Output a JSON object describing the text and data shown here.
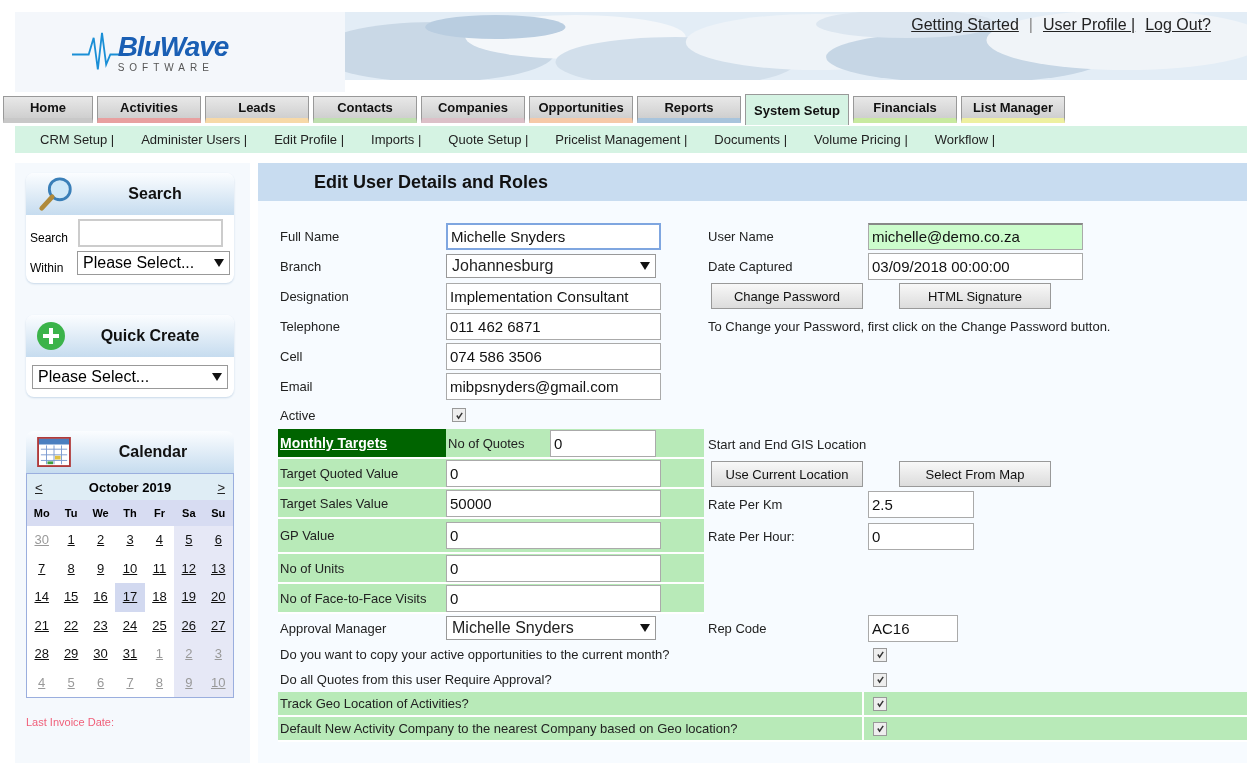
{
  "header": {
    "logo": {
      "name": "BluWave",
      "tagline": "SOFTWARE"
    },
    "links": [
      "Getting Started",
      "User Profile |",
      "Log Out?"
    ],
    "separator": "|"
  },
  "tabs": [
    {
      "label": "Home",
      "selected": false,
      "color": "#c8c8c8"
    },
    {
      "label": "Activities",
      "selected": false,
      "color": "#e8a0a0"
    },
    {
      "label": "Leads",
      "selected": false,
      "color": "#f7d9a8"
    },
    {
      "label": "Contacts",
      "selected": false,
      "color": "#bfe0b0"
    },
    {
      "label": "Companies",
      "selected": false,
      "color": "#dcc0c8"
    },
    {
      "label": "Opportunities",
      "selected": false,
      "color": "#f6c9a8"
    },
    {
      "label": "Reports",
      "selected": false,
      "color": "#a8c4dc"
    },
    {
      "label": "System Setup",
      "selected": true,
      "color": "#d5f3e3"
    },
    {
      "label": "Financials",
      "selected": false,
      "color": "#c8eaa0"
    },
    {
      "label": "List Manager",
      "selected": false,
      "color": "#eef0a0"
    }
  ],
  "subnav": [
    "CRM Setup |",
    "Administer Users |",
    "Edit Profile |",
    "Imports |",
    "Quote Setup |",
    "Pricelist Management |",
    "Documents |",
    "Volume Pricing |",
    "Workflow |"
  ],
  "sidebar": {
    "search": {
      "title": "Search",
      "search_label": "Search",
      "within_label": "Within",
      "within_value": "Please Select..."
    },
    "quick_create": {
      "title": "Quick Create",
      "value": "Please Select..."
    },
    "calendar": {
      "title": "Calendar",
      "prev": "<",
      "month": "October 2019",
      "next": ">",
      "weekdays": [
        "Mo",
        "Tu",
        "We",
        "Th",
        "Fr",
        "Sa",
        "Su"
      ],
      "weeks": [
        [
          {
            "day": "30",
            "muted": true,
            "selected": false
          },
          {
            "day": "1",
            "muted": false,
            "selected": false
          },
          {
            "day": "2",
            "muted": false,
            "selected": false
          },
          {
            "day": "3",
            "muted": false,
            "selected": false
          },
          {
            "day": "4",
            "muted": false,
            "selected": false
          },
          {
            "day": "5",
            "muted": false,
            "selected": false
          },
          {
            "day": "6",
            "muted": false,
            "selected": false
          }
        ],
        [
          {
            "day": "7",
            "muted": false,
            "selected": false
          },
          {
            "day": "8",
            "muted": false,
            "selected": false
          },
          {
            "day": "9",
            "muted": false,
            "selected": false
          },
          {
            "day": "10",
            "muted": false,
            "selected": false
          },
          {
            "day": "11",
            "muted": false,
            "selected": false
          },
          {
            "day": "12",
            "muted": false,
            "selected": false
          },
          {
            "day": "13",
            "muted": false,
            "selected": false
          }
        ],
        [
          {
            "day": "14",
            "muted": false,
            "selected": false
          },
          {
            "day": "15",
            "muted": false,
            "selected": false
          },
          {
            "day": "16",
            "muted": false,
            "selected": false
          },
          {
            "day": "17",
            "muted": false,
            "selected": true
          },
          {
            "day": "18",
            "muted": false,
            "selected": false
          },
          {
            "day": "19",
            "muted": false,
            "selected": false
          },
          {
            "day": "20",
            "muted": false,
            "selected": false
          }
        ],
        [
          {
            "day": "21",
            "muted": false,
            "selected": false
          },
          {
            "day": "22",
            "muted": false,
            "selected": false
          },
          {
            "day": "23",
            "muted": false,
            "selected": false
          },
          {
            "day": "24",
            "muted": false,
            "selected": false
          },
          {
            "day": "25",
            "muted": false,
            "selected": false
          },
          {
            "day": "26",
            "muted": false,
            "selected": false
          },
          {
            "day": "27",
            "muted": false,
            "selected": false
          }
        ],
        [
          {
            "day": "28",
            "muted": false,
            "selected": false
          },
          {
            "day": "29",
            "muted": false,
            "selected": false
          },
          {
            "day": "30",
            "muted": false,
            "selected": false
          },
          {
            "day": "31",
            "muted": false,
            "selected": false
          },
          {
            "day": "1",
            "muted": true,
            "selected": false
          },
          {
            "day": "2",
            "muted": true,
            "selected": false
          },
          {
            "day": "3",
            "muted": true,
            "selected": false
          }
        ],
        [
          {
            "day": "4",
            "muted": true,
            "selected": false
          },
          {
            "day": "5",
            "muted": true,
            "selected": false
          },
          {
            "day": "6",
            "muted": true,
            "selected": false
          },
          {
            "day": "7",
            "muted": true,
            "selected": false
          },
          {
            "day": "8",
            "muted": true,
            "selected": false
          },
          {
            "day": "9",
            "muted": true,
            "selected": false
          },
          {
            "day": "10",
            "muted": true,
            "selected": false
          }
        ]
      ]
    },
    "last_invoice": "Last Invoice Date:"
  },
  "form": {
    "title": "Edit User Details and Roles",
    "rows": [
      {
        "left": {
          "kind": "text",
          "label": "Full Name",
          "value": "Michelle Snyders",
          "focused": true
        },
        "right": {
          "kind": "text",
          "label": "User Name",
          "value": "michelle@demo.co.za",
          "highlighted": true
        }
      },
      {
        "left": {
          "kind": "select",
          "label": "Branch",
          "value": "Johannesburg"
        },
        "right": {
          "kind": "text",
          "label": "Date Captured",
          "value": "03/09/2018 00:00:00",
          "highlighted": false
        }
      },
      {
        "left": {
          "kind": "text",
          "label": "Designation",
          "value": "Implementation Consultant",
          "focused": false
        },
        "right": {
          "kind": "buttons",
          "buttons": [
            "Change Password",
            "HTML Signature"
          ]
        }
      },
      {
        "left": {
          "kind": "text",
          "label": "Telephone",
          "value": "011 462 6871",
          "focused": false
        },
        "right": {
          "kind": "note",
          "text": "To Change your Password, first click on the Change Password button."
        }
      },
      {
        "left": {
          "kind": "text",
          "label": "Cell",
          "value": "074 586 3506",
          "focused": false
        }
      },
      {
        "left": {
          "kind": "text",
          "label": "Email",
          "value": "mibpsnyders@gmail.com",
          "focused": false
        }
      },
      {
        "left": {
          "kind": "checkbox",
          "label": "Active",
          "checked": true
        }
      },
      {
        "left": {
          "kind": "targets_header",
          "label": "Monthly Targets",
          "sublabel": "No of Quotes",
          "value": "0"
        },
        "right": {
          "kind": "note",
          "text": "Start and End GIS Location"
        }
      },
      {
        "left": {
          "kind": "target",
          "label": "Target Quoted Value",
          "value": "0"
        },
        "right": {
          "kind": "buttons",
          "buttons": [
            "Use Current Location",
            "Select From Map"
          ]
        }
      },
      {
        "left": {
          "kind": "target",
          "label": "Target Sales Value",
          "value": "50000"
        },
        "right": {
          "kind": "short",
          "label": "Rate Per Km",
          "value": "2.5"
        }
      },
      {
        "left": {
          "kind": "target",
          "label": "GP Value",
          "value": "0"
        },
        "right": {
          "kind": "short",
          "label": "Rate Per Hour:",
          "value": "0"
        }
      },
      {
        "left": {
          "kind": "target",
          "label": "No of Units",
          "value": "0"
        }
      },
      {
        "left": {
          "kind": "target",
          "label": "No of Face-to-Face Visits",
          "value": "0"
        }
      },
      {
        "left": {
          "kind": "select",
          "label": "Approval Manager",
          "value": "Michelle Snyders"
        },
        "right": {
          "kind": "code",
          "label": "Rep Code",
          "value": "AC16"
        }
      }
    ],
    "questions": [
      {
        "text": "Do you want to copy your active opportunities to the current month?",
        "checked": true,
        "shaded": false
      },
      {
        "text": "Do all Quotes from this user Require Approval?",
        "checked": true,
        "shaded": false
      },
      {
        "text": "Track Geo Location of Activities?",
        "checked": true,
        "shaded": true
      },
      {
        "text": "Default New Activity Company to the nearest Company based on Geo location?",
        "checked": true,
        "shaded": true
      }
    ]
  }
}
